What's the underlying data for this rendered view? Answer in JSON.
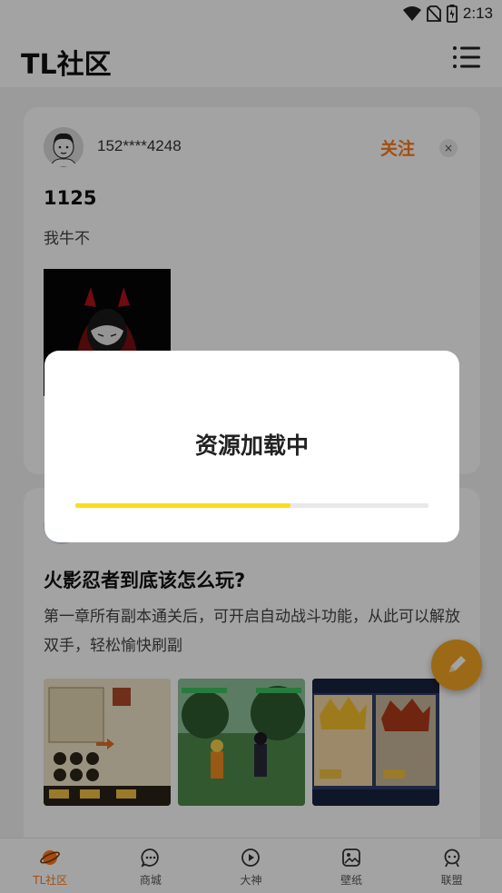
{
  "status_bar": {
    "time": "2:13",
    "icons": [
      "wifi-icon",
      "no-sim-icon",
      "battery-icon"
    ]
  },
  "header": {
    "title": "TL社区",
    "menu_icon": "list-menu-icon"
  },
  "post": {
    "username": "152****4248",
    "follow_label": "关注",
    "close_label": "×",
    "title": "1125",
    "text": "我牛不"
  },
  "article": {
    "title": "火影忍者到底该怎么玩?",
    "summary": "第一章所有副本通关后，可开启自动战斗功能，从此可以解放双手，轻松愉快刷副"
  },
  "fab": {
    "icon": "edit-pencil-icon"
  },
  "tabs": [
    {
      "label": "TL社区",
      "icon": "planet-icon",
      "active": true
    },
    {
      "label": "商城",
      "icon": "chat-bubble-icon",
      "active": false
    },
    {
      "label": "大神",
      "icon": "play-circle-icon",
      "active": false
    },
    {
      "label": "壁纸",
      "icon": "image-icon",
      "active": false
    },
    {
      "label": "联盟",
      "icon": "robot-face-icon",
      "active": false
    }
  ],
  "dialog": {
    "title": "资源加载中",
    "progress": 0.61
  },
  "colors": {
    "accent": "#ff7a1a",
    "progress": "#f7e01b",
    "fab": "#f5a623"
  }
}
